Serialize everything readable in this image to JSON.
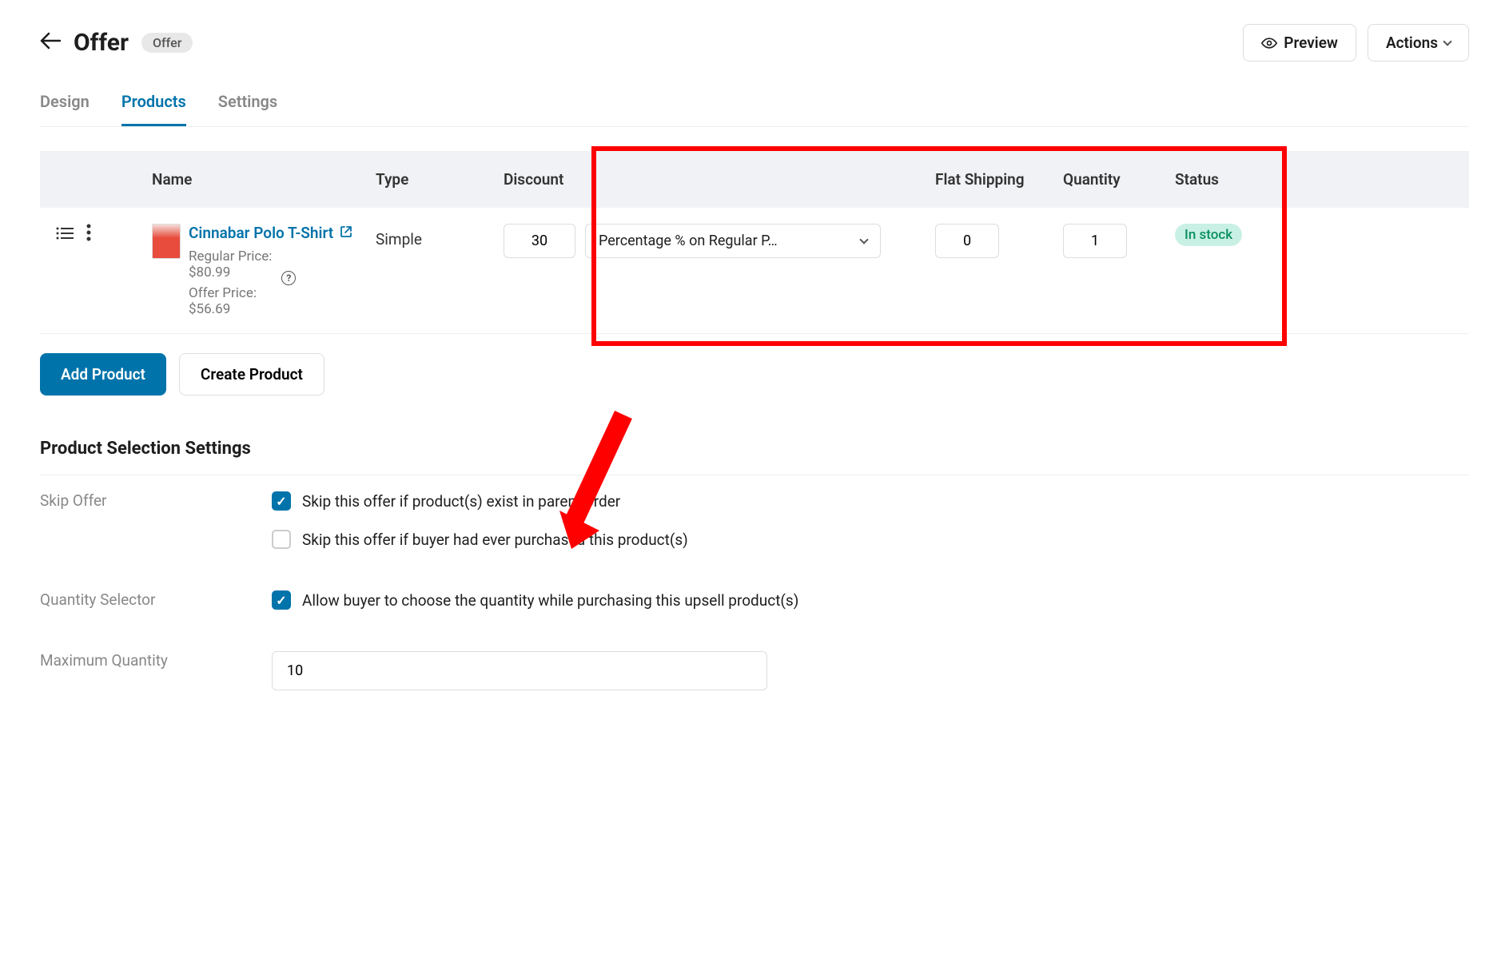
{
  "header": {
    "title": "Offer",
    "badge": "Offer",
    "preview_label": "Preview",
    "actions_label": "Actions"
  },
  "tabs": [
    {
      "label": "Design",
      "active": false
    },
    {
      "label": "Products",
      "active": true
    },
    {
      "label": "Settings",
      "active": false
    }
  ],
  "table": {
    "columns": {
      "name": "Name",
      "type": "Type",
      "discount": "Discount",
      "flat_shipping": "Flat Shipping",
      "quantity": "Quantity",
      "status": "Status"
    },
    "rows": [
      {
        "name": "Cinnabar Polo T-Shirt",
        "type": "Simple",
        "regular_price_label": "Regular Price:",
        "regular_price": "$80.99",
        "offer_price_label": "Offer Price:",
        "offer_price": "$56.69",
        "discount_value": "30",
        "discount_type": "Percentage % on Regular P…",
        "flat_shipping": "0",
        "quantity": "1",
        "status": "In stock"
      }
    ]
  },
  "buttons": {
    "add_product": "Add Product",
    "create_product": "Create Product"
  },
  "settings_section": {
    "title": "Product Selection Settings",
    "skip_offer": {
      "label": "Skip Offer",
      "option1": "Skip this offer if product(s) exist in parent order",
      "option1_checked": true,
      "option2": "Skip this offer if buyer had ever purchased this product(s)",
      "option2_checked": false
    },
    "quantity_selector": {
      "label": "Quantity Selector",
      "option": "Allow buyer to choose the quantity while purchasing this upsell product(s)",
      "checked": true
    },
    "max_quantity": {
      "label": "Maximum Quantity",
      "value": "10"
    }
  }
}
